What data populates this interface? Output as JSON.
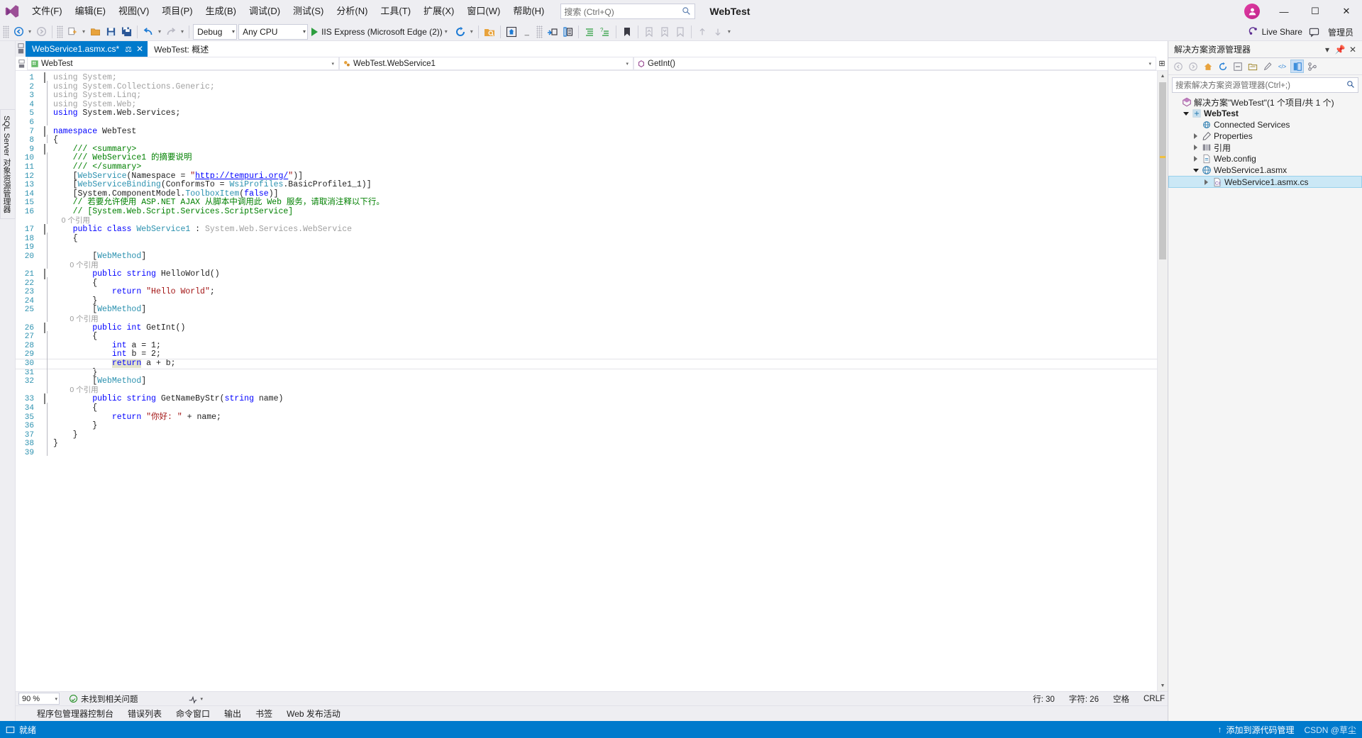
{
  "app": {
    "title": "WebTest",
    "avatar_initial": "",
    "logo_name": "visual-studio-logo"
  },
  "menu": {
    "items": [
      {
        "label": "文件(F)"
      },
      {
        "label": "编辑(E)"
      },
      {
        "label": "视图(V)"
      },
      {
        "label": "项目(P)"
      },
      {
        "label": "生成(B)"
      },
      {
        "label": "调试(D)"
      },
      {
        "label": "测试(S)"
      },
      {
        "label": "分析(N)"
      },
      {
        "label": "工具(T)"
      },
      {
        "label": "扩展(X)"
      },
      {
        "label": "窗口(W)"
      },
      {
        "label": "帮助(H)"
      }
    ]
  },
  "search": {
    "placeholder": "搜索 (Ctrl+Q)"
  },
  "window_buttons": {
    "minimize": "—",
    "maximize": "☐",
    "close": "✕"
  },
  "toolbar": {
    "configuration": "Debug",
    "platform": "Any CPU",
    "run_target": "IIS Express (Microsoft Edge (2))",
    "live_share": "Live Share",
    "manager": "管理员"
  },
  "tabs": [
    {
      "label": "WebService1.asmx.cs*",
      "active": true,
      "pin": "⚖",
      "close": "✕"
    },
    {
      "label": "WebTest: 概述",
      "active": false
    }
  ],
  "navbar": {
    "project": "WebTest",
    "type": "WebTest.WebService1",
    "member": "GetInt()"
  },
  "editor": {
    "zoom": "90 %",
    "issues": "未找到相关问题",
    "line_label": "行: 30",
    "column_label": "字符: 26",
    "insert_mode": "空格",
    "line_ending": "CRLF",
    "lines": [
      {
        "n": 1,
        "fold": "minus",
        "mod": false,
        "tokens": [
          {
            "t": "using ",
            "c": "c-gray"
          },
          {
            "t": "System;",
            "c": "c-gray"
          }
        ]
      },
      {
        "n": 2,
        "fold": "",
        "mod": false,
        "tokens": [
          {
            "t": "using ",
            "c": "c-gray"
          },
          {
            "t": "System.Collections.Generic;",
            "c": "c-gray"
          }
        ]
      },
      {
        "n": 3,
        "fold": "",
        "mod": false,
        "tokens": [
          {
            "t": "using ",
            "c": "c-gray"
          },
          {
            "t": "System.Linq;",
            "c": "c-gray"
          }
        ]
      },
      {
        "n": 4,
        "fold": "",
        "mod": false,
        "tokens": [
          {
            "t": "using ",
            "c": "c-gray"
          },
          {
            "t": "System.Web;",
            "c": "c-gray"
          }
        ]
      },
      {
        "n": 5,
        "fold": "",
        "mod": false,
        "tokens": [
          {
            "t": "using ",
            "c": "c-kw"
          },
          {
            "t": "System.Web.Services;",
            "c": "c-txt"
          }
        ]
      },
      {
        "n": 6,
        "fold": "",
        "mod": false,
        "tokens": []
      },
      {
        "n": 7,
        "fold": "minus",
        "mod": false,
        "tokens": [
          {
            "t": "namespace ",
            "c": "c-kw"
          },
          {
            "t": "WebTest",
            "c": "c-txt"
          }
        ]
      },
      {
        "n": 8,
        "fold": "",
        "mod": false,
        "tokens": [
          {
            "t": "{",
            "c": "c-txt"
          }
        ]
      },
      {
        "n": 9,
        "fold": "minus",
        "mod": false,
        "indent": 1,
        "tokens": [
          {
            "t": "/// <summary>",
            "c": "c-com"
          }
        ]
      },
      {
        "n": 10,
        "fold": "",
        "mod": false,
        "indent": 1,
        "tokens": [
          {
            "t": "/// WebService1 的摘要说明",
            "c": "c-com"
          }
        ]
      },
      {
        "n": 11,
        "fold": "",
        "mod": false,
        "indent": 1,
        "tokens": [
          {
            "t": "/// </summary>",
            "c": "c-com"
          }
        ]
      },
      {
        "n": 12,
        "fold": "",
        "mod": false,
        "indent": 1,
        "tokens": [
          {
            "t": "[",
            "c": "c-txt"
          },
          {
            "t": "WebService",
            "c": "c-type"
          },
          {
            "t": "(Namespace = ",
            "c": "c-txt"
          },
          {
            "t": "\"",
            "c": "c-str"
          },
          {
            "t": "http://tempuri.org/",
            "c": "c-link"
          },
          {
            "t": "\"",
            "c": "c-str"
          },
          {
            "t": ")]",
            "c": "c-txt"
          }
        ]
      },
      {
        "n": 13,
        "fold": "",
        "mod": false,
        "indent": 1,
        "tokens": [
          {
            "t": "[",
            "c": "c-txt"
          },
          {
            "t": "WebServiceBinding",
            "c": "c-type"
          },
          {
            "t": "(ConformsTo = ",
            "c": "c-txt"
          },
          {
            "t": "WsiProfiles",
            "c": "c-type"
          },
          {
            "t": ".BasicProfile1_1)]",
            "c": "c-txt"
          }
        ]
      },
      {
        "n": 14,
        "fold": "",
        "mod": false,
        "indent": 1,
        "tokens": [
          {
            "t": "[System.ComponentModel.",
            "c": "c-txt"
          },
          {
            "t": "ToolboxItem",
            "c": "c-type"
          },
          {
            "t": "(",
            "c": "c-txt"
          },
          {
            "t": "false",
            "c": "c-kw"
          },
          {
            "t": ")]",
            "c": "c-txt"
          }
        ]
      },
      {
        "n": 15,
        "fold": "",
        "mod": false,
        "indent": 1,
        "tokens": [
          {
            "t": "// 若要允许使用 ASP.NET AJAX 从脚本中调用此 Web 服务，请取消注释以下行。",
            "c": "c-com"
          }
        ]
      },
      {
        "n": 16,
        "fold": "",
        "mod": false,
        "indent": 1,
        "tokens": [
          {
            "t": "// [System.Web.Script.Services.ScriptService]",
            "c": "c-com"
          }
        ]
      },
      {
        "n": "",
        "fold": "",
        "mod": false,
        "indent": 1,
        "ref": "0 个引用"
      },
      {
        "n": 17,
        "fold": "minus",
        "mod": false,
        "indent": 1,
        "tokens": [
          {
            "t": "public class ",
            "c": "c-kw"
          },
          {
            "t": "WebService1",
            "c": "c-type"
          },
          {
            "t": " : ",
            "c": "c-txt"
          },
          {
            "t": "System.Web.Services.WebService",
            "c": "c-gray"
          }
        ]
      },
      {
        "n": 18,
        "fold": "",
        "mod": false,
        "indent": 1,
        "tokens": [
          {
            "t": "{",
            "c": "c-txt"
          }
        ]
      },
      {
        "n": 19,
        "fold": "",
        "mod": false,
        "tokens": []
      },
      {
        "n": 20,
        "fold": "",
        "mod": false,
        "indent": 2,
        "tokens": [
          {
            "t": "[",
            "c": "c-txt"
          },
          {
            "t": "WebMethod",
            "c": "c-type"
          },
          {
            "t": "]",
            "c": "c-txt"
          }
        ]
      },
      {
        "n": "",
        "fold": "",
        "mod": false,
        "indent": 2,
        "ref": "0 个引用"
      },
      {
        "n": 21,
        "fold": "minus",
        "mod": false,
        "indent": 2,
        "tokens": [
          {
            "t": "public string ",
            "c": "c-kw"
          },
          {
            "t": "HelloWorld()",
            "c": "c-txt"
          }
        ]
      },
      {
        "n": 22,
        "fold": "",
        "mod": false,
        "indent": 2,
        "tokens": [
          {
            "t": "{",
            "c": "c-txt"
          }
        ]
      },
      {
        "n": 23,
        "fold": "",
        "mod": false,
        "indent": 3,
        "tokens": [
          {
            "t": "return ",
            "c": "c-kw"
          },
          {
            "t": "\"Hello World\"",
            "c": "c-str"
          },
          {
            "t": ";",
            "c": "c-txt"
          }
        ]
      },
      {
        "n": 24,
        "fold": "",
        "mod": true,
        "indent": 2,
        "tokens": [
          {
            "t": "}",
            "c": "c-txt"
          }
        ]
      },
      {
        "n": 25,
        "fold": "",
        "mod": true,
        "indent": 2,
        "tokens": [
          {
            "t": "[",
            "c": "c-txt"
          },
          {
            "t": "WebMethod",
            "c": "c-type"
          },
          {
            "t": "]",
            "c": "c-txt"
          }
        ]
      },
      {
        "n": "",
        "fold": "",
        "mod": true,
        "indent": 2,
        "ref": "0 个引用"
      },
      {
        "n": 26,
        "fold": "minus",
        "mod": true,
        "indent": 2,
        "tokens": [
          {
            "t": "public int ",
            "c": "c-kw"
          },
          {
            "t": "GetInt()",
            "c": "c-txt"
          }
        ]
      },
      {
        "n": 27,
        "fold": "",
        "mod": true,
        "indent": 2,
        "tokens": [
          {
            "t": "{",
            "c": "c-txt"
          }
        ]
      },
      {
        "n": 28,
        "fold": "",
        "mod": true,
        "indent": 3,
        "tokens": [
          {
            "t": "int ",
            "c": "c-kw"
          },
          {
            "t": "a = ",
            "c": "c-txt"
          },
          {
            "t": "1",
            "c": "c-txt"
          },
          {
            "t": ";",
            "c": "c-txt"
          }
        ]
      },
      {
        "n": 29,
        "fold": "",
        "mod": true,
        "indent": 3,
        "tokens": [
          {
            "t": "int ",
            "c": "c-kw"
          },
          {
            "t": "b = ",
            "c": "c-txt"
          },
          {
            "t": "2",
            "c": "c-txt"
          },
          {
            "t": ";",
            "c": "c-txt"
          }
        ]
      },
      {
        "n": 30,
        "fold": "",
        "mod": true,
        "indent": 3,
        "current": true,
        "tokens": [
          {
            "t": "return",
            "c": "c-kw sel-hl"
          },
          {
            "t": " a + b;",
            "c": "c-txt"
          }
        ]
      },
      {
        "n": 31,
        "fold": "",
        "mod": true,
        "indent": 2,
        "tokens": [
          {
            "t": "}",
            "c": "c-txt"
          }
        ]
      },
      {
        "n": 32,
        "fold": "",
        "mod": true,
        "indent": 2,
        "tokens": [
          {
            "t": "[",
            "c": "c-txt"
          },
          {
            "t": "WebMethod",
            "c": "c-type"
          },
          {
            "t": "]",
            "c": "c-txt"
          }
        ]
      },
      {
        "n": "",
        "fold": "",
        "mod": true,
        "indent": 2,
        "ref": "0 个引用"
      },
      {
        "n": 33,
        "fold": "minus",
        "mod": true,
        "indent": 2,
        "tokens": [
          {
            "t": "public string ",
            "c": "c-kw"
          },
          {
            "t": "GetNameByStr(",
            "c": "c-txt"
          },
          {
            "t": "string ",
            "c": "c-kw"
          },
          {
            "t": "name)",
            "c": "c-txt"
          }
        ]
      },
      {
        "n": 34,
        "fold": "",
        "mod": true,
        "indent": 2,
        "tokens": [
          {
            "t": "{",
            "c": "c-txt"
          }
        ]
      },
      {
        "n": 35,
        "fold": "",
        "mod": true,
        "indent": 3,
        "tokens": [
          {
            "t": "return ",
            "c": "c-kw"
          },
          {
            "t": "\"你好: \"",
            "c": "c-str"
          },
          {
            "t": " + name;",
            "c": "c-txt"
          }
        ]
      },
      {
        "n": 36,
        "fold": "",
        "mod": true,
        "indent": 2,
        "tokens": [
          {
            "t": "}",
            "c": "c-txt"
          }
        ]
      },
      {
        "n": 37,
        "fold": "",
        "mod": false,
        "indent": 1,
        "tokens": [
          {
            "t": "}",
            "c": "c-txt"
          }
        ]
      },
      {
        "n": 38,
        "fold": "",
        "mod": false,
        "tokens": [
          {
            "t": "}",
            "c": "c-txt"
          }
        ]
      },
      {
        "n": 39,
        "fold": "",
        "mod": false,
        "tokens": []
      }
    ]
  },
  "dock_tabs": [
    {
      "label": "程序包管理器控制台"
    },
    {
      "label": "错误列表"
    },
    {
      "label": "命令窗口"
    },
    {
      "label": "输出"
    },
    {
      "label": "书签"
    },
    {
      "label": "Web 发布活动"
    }
  ],
  "solution_explorer": {
    "title": "解决方案资源管理器",
    "search_placeholder": "搜索解决方案资源管理器(Ctrl+;)",
    "tree": [
      {
        "label": "解决方案\"WebTest\"(1 个项目/共 1 个)",
        "depth": 0,
        "twisty": "none",
        "icon": "solution-icon",
        "bold": false,
        "selected": false
      },
      {
        "label": "WebTest",
        "depth": 1,
        "twisty": "down",
        "icon": "project-icon",
        "bold": true,
        "selected": false
      },
      {
        "label": "Connected Services",
        "depth": 2,
        "twisty": "none",
        "icon": "connected-services-icon",
        "bold": false,
        "selected": false
      },
      {
        "label": "Properties",
        "depth": 2,
        "twisty": "right",
        "icon": "properties-icon",
        "bold": false,
        "selected": false
      },
      {
        "label": "引用",
        "depth": 2,
        "twisty": "right",
        "icon": "references-icon",
        "bold": false,
        "selected": false
      },
      {
        "label": "Web.config",
        "depth": 2,
        "twisty": "right",
        "icon": "config-file-icon",
        "bold": false,
        "selected": false
      },
      {
        "label": "WebService1.asmx",
        "depth": 2,
        "twisty": "down",
        "icon": "asmx-file-icon",
        "bold": false,
        "selected": false
      },
      {
        "label": "WebService1.asmx.cs",
        "depth": 3,
        "twisty": "right",
        "icon": "csharp-file-icon",
        "bold": false,
        "selected": true
      }
    ]
  },
  "left_strip": {
    "vtab_label": "SQL Server 对象资源管理器"
  },
  "statusbar": {
    "state": "就绪",
    "publish": "添加到源代码管理",
    "watermark": "CSDN @草尘"
  }
}
